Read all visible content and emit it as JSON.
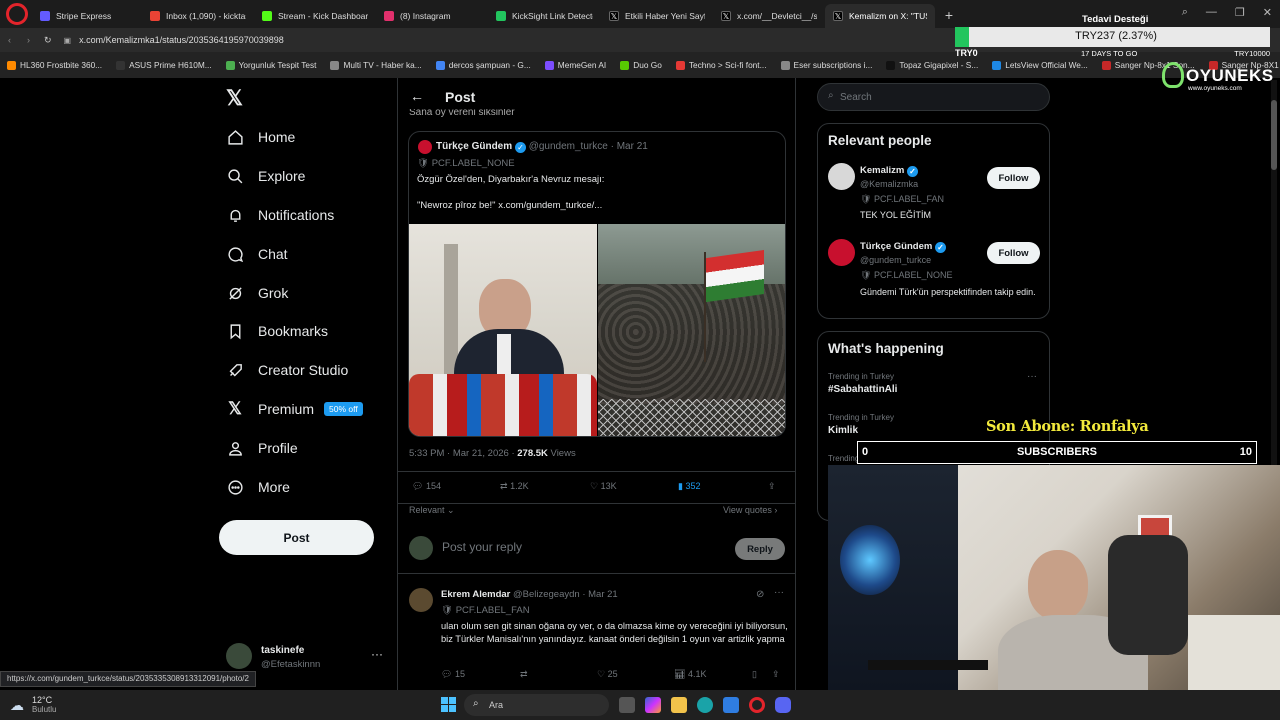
{
  "browser": {
    "tabs": [
      {
        "label": "Stripe Express",
        "color": "#635bff",
        "active": false
      },
      {
        "label": "Inbox (1,090) - kicktasking",
        "color": "#ea4335",
        "active": false
      },
      {
        "label": "Stream - Kick Dashboard",
        "color": "#53fc18",
        "active": false
      },
      {
        "label": "(8) Instagram",
        "color": "#e1306c",
        "active": false
      },
      {
        "label": "KickSight Link Detector",
        "color": "#22c55e",
        "active": false
      },
      {
        "label": "Etkili Haber Yeni Sayfa on",
        "color": "#000000",
        "active": false
      },
      {
        "label": "x.com/__Devletci__/stat",
        "color": "#000000",
        "active": false
      },
      {
        "label": "Kemalizm on X: \"TUSAŞ k",
        "color": "#000000",
        "active": true
      }
    ],
    "url": "x.com/Kemalizmka1/status/2035364195970039898",
    "bookmarks": [
      {
        "label": "HL360 Frostbite 360...",
        "color": "#ff8a00"
      },
      {
        "label": "ASUS Prime H610M...",
        "color": "#333333"
      },
      {
        "label": "Yorgunluk Tespit Test",
        "color": "#4caf50"
      },
      {
        "label": "Multi TV - Haber ka...",
        "color": "#888888"
      },
      {
        "label": "dercos şampuan - G...",
        "color": "#4285f4"
      },
      {
        "label": "MemeGen AI",
        "color": "#7c4dff"
      },
      {
        "label": "Duo Go",
        "color": "#58cc02"
      },
      {
        "label": "Techno > Sci-fi font...",
        "color": "#e53935"
      },
      {
        "label": "Eser subscriptions i...",
        "color": "#888888"
      },
      {
        "label": "Topaz Gigapixel - S...",
        "color": "#111111"
      },
      {
        "label": "LetsView Official We...",
        "color": "#1e88e5"
      },
      {
        "label": "Sanger Np-8x1 Son...",
        "color": "#c62828"
      },
      {
        "label": "Sanger Np-8X1 Son...",
        "color": "#c62828"
      }
    ],
    "status_url": "https://x.com/gundem_turkce/status/2035335308913312091/photo/2"
  },
  "donation": {
    "title": "Tedavi Desteği",
    "amount": "TRY237 (2.37%)",
    "days_left": "17 DAYS TO GO",
    "min": "TRY0",
    "max": "TRY10000",
    "progress": 0.0237
  },
  "sponsor": {
    "name": "OYUNEKS",
    "site": "www.oyuneks.com"
  },
  "nav": {
    "items": [
      {
        "key": "home",
        "label": "Home"
      },
      {
        "key": "explore",
        "label": "Explore"
      },
      {
        "key": "notifications",
        "label": "Notifications"
      },
      {
        "key": "chat",
        "label": "Chat"
      },
      {
        "key": "grok",
        "label": "Grok"
      },
      {
        "key": "bookmarks",
        "label": "Bookmarks"
      },
      {
        "key": "creator-studio",
        "label": "Creator Studio"
      },
      {
        "key": "premium",
        "label": "Premium"
      },
      {
        "key": "profile",
        "label": "Profile"
      },
      {
        "key": "more",
        "label": "More"
      }
    ],
    "premium_badge": "50% off",
    "post_button": "Post",
    "account": {
      "name": "taskinefe",
      "handle": "@Efetaskinnn"
    }
  },
  "post": {
    "header": "Post",
    "partial_text": "Sana oy vereni siksinler",
    "quoted": {
      "name": "Türkçe Gündem",
      "handle": "@gundem_turkce",
      "date": "Mar 21",
      "label": "PCF.LABEL_NONE",
      "text1": "Özgür Özel'den, Diyarbakır'a Nevruz mesajı:",
      "text2": "\"Newroz pîroz be!\"  x.com/gundem_turkce/..."
    },
    "timestamp": "5:33 PM · Mar 21, 2026 · ",
    "views": "278.5K",
    "views_label": "Views",
    "actions": {
      "replies": "154",
      "reposts": "1.2K",
      "likes": "13K",
      "bookmarks": "352"
    },
    "sort": "Relevant",
    "view_quotes": "View quotes",
    "reply_placeholder": "Post your reply",
    "reply_button": "Reply"
  },
  "reply": {
    "name": "Ekrem Alemdar",
    "handle": "@Belizegeaydn",
    "date": "Mar 21",
    "label": "PCF.LABEL_FAN",
    "text": "ulan olum sen git sinan oğana oy ver, o da olmazsa kime oy vereceğini iyi biliyorsun, biz Türkler Manisalı'nın yanındayız. kanaat önderi değilsin 1 oyun var artizlik yapma",
    "replies": "15",
    "likes": "25",
    "views": "4.1K"
  },
  "sidebar": {
    "search_placeholder": "Search",
    "relevant_title": "Relevant people",
    "people": [
      {
        "name": "Kemalizm",
        "handle": "@Kemalizmka",
        "label": "PCF.LABEL_FAN",
        "bio": "TEK YOL EĞİTİM",
        "follow": "Follow"
      },
      {
        "name": "Türkçe Gündem",
        "handle": "@gundem_turkce",
        "label": "PCF.LABEL_NONE",
        "bio": "Gündemi Türk'ün perspektifinden takip edin.",
        "follow": "Follow"
      }
    ],
    "happening_title": "What's happening",
    "trends": [
      {
        "context": "Trending in Turkey",
        "name": "#SabahattinAli"
      },
      {
        "context": "Trending in Turkey",
        "name": "Kimlik"
      },
      {
        "context": "Trending in Turkey",
        "name": ""
      }
    ]
  },
  "stream": {
    "last_sub_label": "Son Abone: Ronfalya",
    "subs_label": "SUBSCRIBERS",
    "subs_min": "0",
    "subs_max": "10"
  },
  "taskbar": {
    "temperature": "12°C",
    "weather": "Bulutlu",
    "search_placeholder": "Ara"
  }
}
